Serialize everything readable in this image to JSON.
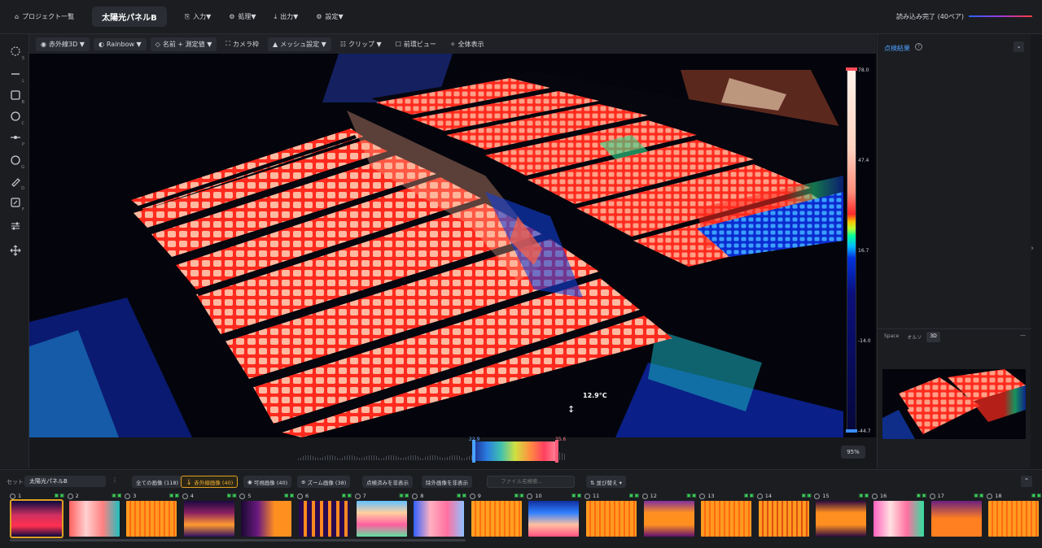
{
  "topbar": {
    "project_list": "プロジェクト一覧",
    "project_title": "太陽光パネルB",
    "menus": [
      "入力▼",
      "処理▼",
      "出力▼",
      "設定▼"
    ],
    "status": "読み込み完了 (40ペア)"
  },
  "left_tools": [
    {
      "icon": "lasso-select-icon",
      "key": "S"
    },
    {
      "icon": "line-icon",
      "key": "L"
    },
    {
      "icon": "rectangle-icon",
      "key": "B"
    },
    {
      "icon": "circle-icon",
      "key": "C"
    },
    {
      "icon": "polyline-icon",
      "key": "P"
    },
    {
      "icon": "polygon-icon",
      "key": "G"
    },
    {
      "icon": "pencil-icon",
      "key": "D"
    },
    {
      "icon": "edit-note-icon",
      "key": "F"
    },
    {
      "icon": "sliders-icon",
      "key": ""
    },
    {
      "icon": "move-icon",
      "key": ""
    }
  ],
  "toolbar": {
    "view_mode": "赤外線3D ▼",
    "palette": "Rainbow ▼",
    "labels": "名前 + 測定値 ▼",
    "camera": "カメラ枠",
    "mesh": "メッシュ設定 ▼",
    "clip": "クリップ ▼",
    "preview": "前環ビュー",
    "fit": "全体表示"
  },
  "colorbar": {
    "ticks": [
      "78.0",
      "47.4",
      "16.7",
      "-14.0",
      "-44.7"
    ]
  },
  "cursor_temp": "12.9°C",
  "range": {
    "min": "22.9",
    "max": "35.6"
  },
  "zoom": "95%",
  "right_panel": {
    "title": "点検結果",
    "help": "?",
    "collapse": "⌄",
    "tabs": [
      "Space",
      "オルソ",
      "3D"
    ],
    "active_tab": "3D",
    "minimize": "—"
  },
  "filmstrip": {
    "set_label": "セット:",
    "set_value": "太陽光パネルB",
    "filters": [
      "全ての画像 (118)",
      "赤外線画像 (40)",
      "可視画像 (40)",
      "ズーム画像 (38)",
      "点検済みを非表示",
      "除外画像を非表示"
    ],
    "active_filter": "赤外線画像 (40)",
    "search_placeholder": "ファイル名検索...",
    "sort": "⇅ 並び替え ▾",
    "thumbs": [
      "1",
      "2",
      "3",
      "4",
      "5",
      "6",
      "7",
      "8",
      "9",
      "10",
      "11",
      "12",
      "13",
      "14",
      "15",
      "16",
      "17",
      "18"
    ],
    "selected": "1"
  },
  "colors": {
    "accent": "#e0a020",
    "link": "#4ea1ff",
    "ok": "#3cd15a"
  }
}
